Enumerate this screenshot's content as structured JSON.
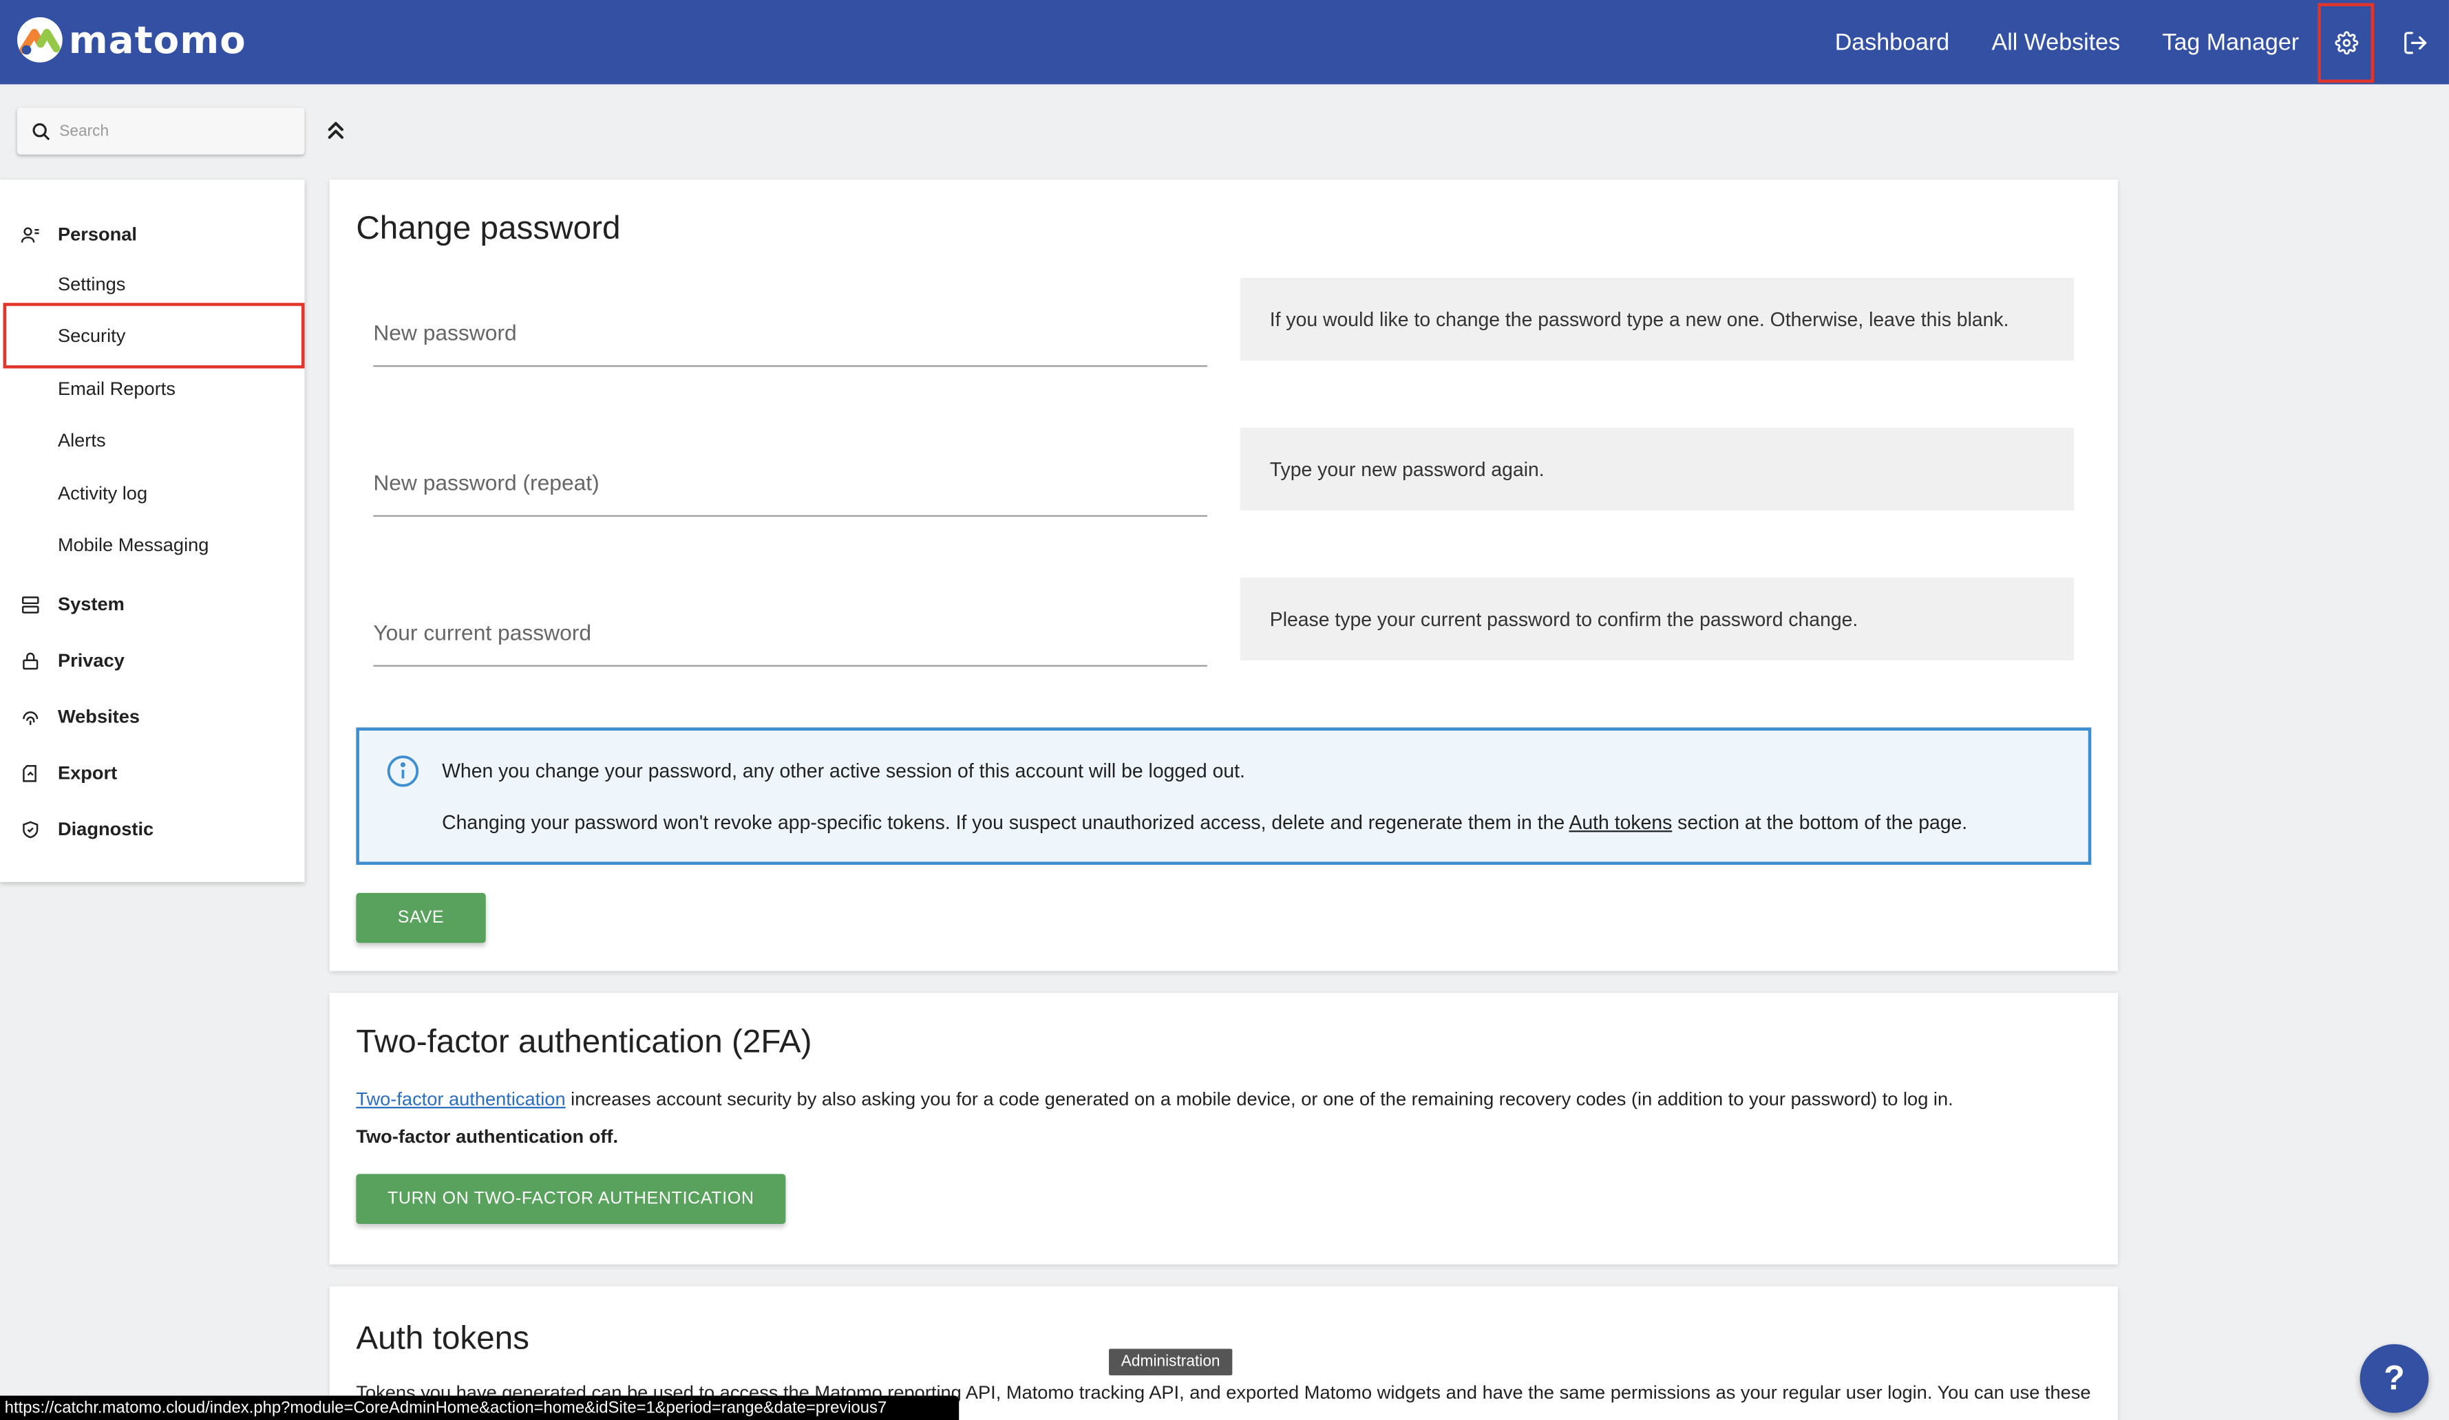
{
  "app": {
    "logo_text": "matomo",
    "brand_color": "#3450a3",
    "accent_red": "#e0362c",
    "button_green": "#58a25e"
  },
  "topnav": {
    "dashboard": "Dashboard",
    "all_websites": "All Websites",
    "tag_manager": "Tag Manager",
    "admin_icon": "gear-icon",
    "logout_icon": "logout-icon"
  },
  "sidebar": {
    "search_placeholder": "Search",
    "categories": [
      {
        "label": "Personal",
        "icon": "users-icon"
      },
      {
        "label": "System",
        "icon": "server-icon"
      },
      {
        "label": "Privacy",
        "icon": "lock-icon"
      },
      {
        "label": "Websites",
        "icon": "fingerprint-icon"
      },
      {
        "label": "Export",
        "icon": "export-icon"
      },
      {
        "label": "Diagnostic",
        "icon": "shield-icon"
      }
    ],
    "personal_items": [
      "Settings",
      "Security",
      "Email Reports",
      "Alerts",
      "Activity log",
      "Mobile Messaging"
    ],
    "active_item": "Security"
  },
  "change_password": {
    "title": "Change password",
    "new_password_placeholder": "New password",
    "new_password_help": "If you would like to change the password type a new one. Otherwise, leave this blank.",
    "repeat_placeholder": "New password (repeat)",
    "repeat_help": "Type your new password again.",
    "current_placeholder": "Your current password",
    "current_help": "Please type your current password to confirm the password change.",
    "notice_line1": "When you change your password, any other active session of this account will be logged out.",
    "notice_line2_before": "Changing your password won't revoke app-specific tokens. If you suspect unauthorized access, delete and regenerate them in the ",
    "notice_link": "Auth tokens",
    "notice_line2_after": " section at the bottom of the page.",
    "save_label": "SAVE"
  },
  "two_factor": {
    "title": "Two-factor authentication (2FA)",
    "link": "Two-factor authentication",
    "description": " increases account security by also asking you for a code generated on a mobile device, or one of the remaining recovery codes (in addition to your password) to log in.",
    "status": "Two-factor authentication off.",
    "button_label": "TURN ON TWO-FACTOR AUTHENTICATION"
  },
  "auth_tokens": {
    "title": "Auth tokens",
    "description": "Tokens you have generated can be used to access the Matomo reporting API, Matomo tracking API, and exported Matomo widgets and have the same permissions as your regular user login. You can use these"
  },
  "overlay": {
    "tooltip": "Administration",
    "status_url": "https://catchr.matomo.cloud/index.php?module=CoreAdminHome&action=home&idSite=1&period=range&date=previous7",
    "help_fab": "?"
  }
}
